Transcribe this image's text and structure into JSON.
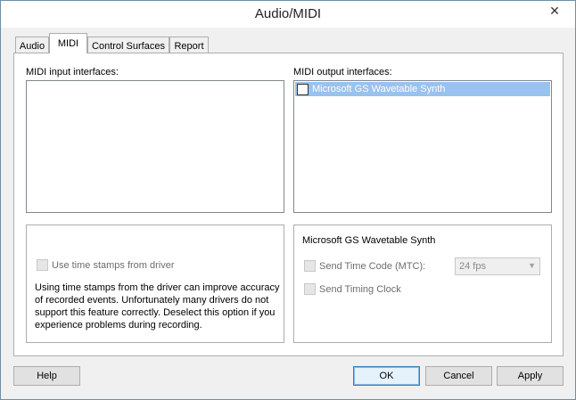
{
  "window": {
    "title": "Audio/MIDI",
    "close_glyph": "✕"
  },
  "tabs": [
    {
      "label": "Audio",
      "active": false
    },
    {
      "label": "MIDI",
      "active": true
    },
    {
      "label": "Control Surfaces",
      "active": false
    },
    {
      "label": "Report",
      "active": false
    }
  ],
  "midi": {
    "input_label": "MIDI input interfaces:",
    "output_label": "MIDI output interfaces:",
    "output_items": [
      {
        "label": "Microsoft GS Wavetable Synth",
        "checked": false,
        "selected": true
      }
    ],
    "timestamps": {
      "checkbox_label": "Use time stamps from driver",
      "description": "Using time stamps from the driver can improve accuracy of recorded events. Unfortunately many drivers do not support this feature correctly. Deselect this option if you experience problems during recording."
    },
    "device_settings": {
      "device_name": "Microsoft GS Wavetable Synth",
      "send_time_code_label": "Send Time Code (MTC):",
      "fps_value": "24 fps",
      "send_timing_clock_label": "Send Timing Clock"
    }
  },
  "buttons": {
    "help": "Help",
    "ok": "OK",
    "cancel": "Cancel",
    "apply": "Apply"
  }
}
